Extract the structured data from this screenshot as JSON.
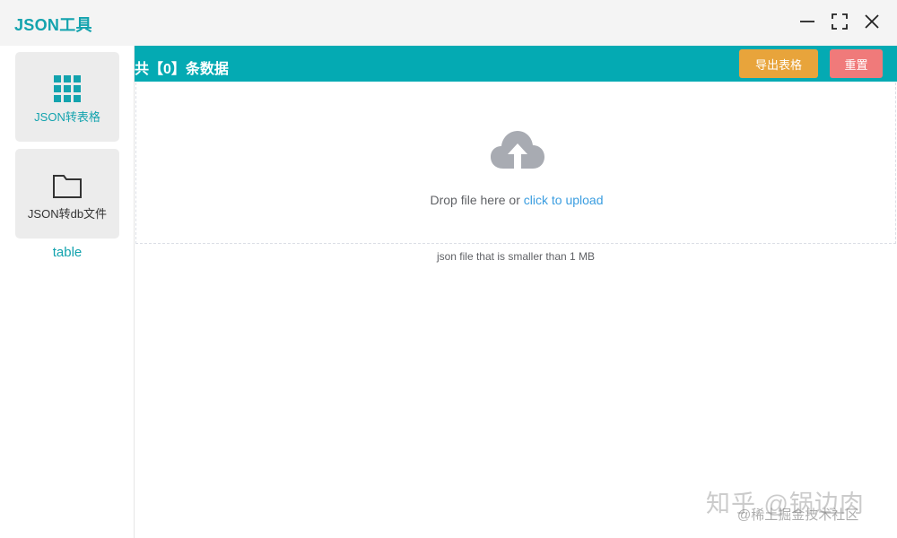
{
  "app": {
    "title": "JSON工具"
  },
  "window_controls": {
    "minimize_icon": "minimize-icon",
    "maximize_icon": "maximize-icon",
    "close_icon": "close-icon"
  },
  "sidebar": {
    "items": [
      {
        "label": "JSON转表格",
        "icon": "grid-icon",
        "color": "#13a3ae"
      },
      {
        "label": "JSON转db文件",
        "icon": "folder-icon",
        "color": "#333333"
      }
    ],
    "table_link": "table"
  },
  "header": {
    "record_count": "共【0】条数据",
    "export_label": "导出表格",
    "reset_label": "重置"
  },
  "upload": {
    "icon": "cloud-upload-icon",
    "text_prefix": "Drop file here or ",
    "text_link": "click to upload",
    "tip": "json file that is smaller than 1 MB"
  },
  "watermark": {
    "main": "知乎 @锅边肉",
    "sub": "@稀土掘金技术社区"
  },
  "colors": {
    "accent": "#04aab3",
    "export": "#e8a43b",
    "reset": "#f07a7a",
    "link": "#3a9de0"
  }
}
